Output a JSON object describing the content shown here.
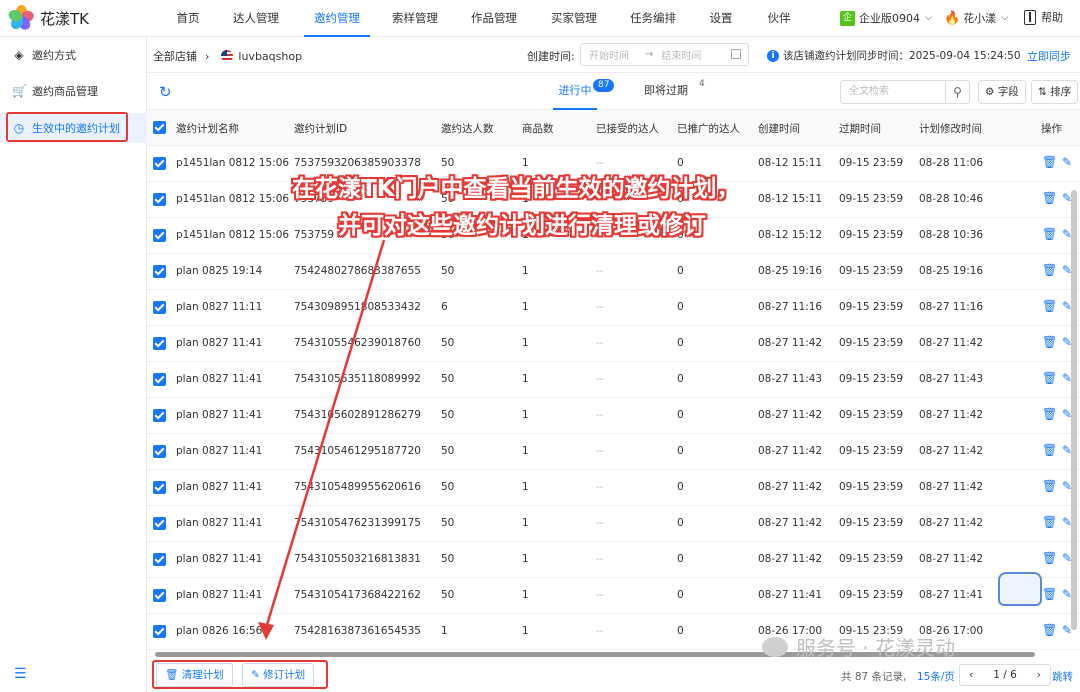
{
  "app": {
    "name": "花漾TK"
  },
  "topnav": {
    "items": [
      "首页",
      "达人管理",
      "邀约管理",
      "索样管理",
      "作品管理",
      "买家管理",
      "任务编排",
      "设置",
      "伙伴"
    ],
    "active_index": 2,
    "edition_icon": "企",
    "edition": "企业版0904",
    "user": "花小漾",
    "help": "帮助"
  },
  "sidebar": {
    "items": [
      {
        "label": "邀约方式",
        "icon": "tag-icon"
      },
      {
        "label": "邀约商品管理",
        "icon": "cart-icon"
      },
      {
        "label": "生效中的邀约计划",
        "icon": "clock-icon"
      }
    ],
    "active_index": 2
  },
  "filterbar": {
    "breadcrumb_root": "全部店铺",
    "shop": "luvbaqshop",
    "created_label": "创建时间:",
    "start_placeholder": "开始时间",
    "end_placeholder": "结束时间",
    "sync_info": "该店铺邀约计划同步时间：2025-09-04 15:24:50",
    "sync_now": "立即同步"
  },
  "tabs": [
    {
      "label": "进行中",
      "badge": "87"
    },
    {
      "label": "即将过期",
      "badge": "4"
    }
  ],
  "toolbar": {
    "search_placeholder": "全文检索",
    "fields_label": "字段",
    "sort_label": "排序"
  },
  "table": {
    "columns": [
      "邀约计划名称",
      "邀约计划ID",
      "邀约达人数",
      "商品数",
      "已接受的达人",
      "已推广的达人",
      "创建时间",
      "过期时间",
      "计划修改时间",
      "操作"
    ],
    "rows": [
      [
        "p1451lan 0812 15:06",
        "7537593206385903378",
        "50",
        "1",
        "--",
        "0",
        "08-12 15:11",
        "09-15 23:59",
        "08-28 11:06"
      ],
      [
        "p1451lan 0812 15:06",
        "753759",
        "50",
        "1",
        "--",
        "0",
        "08-12 15:11",
        "09-15 23:59",
        "08-28 10:46"
      ],
      [
        "p1451lan 0812 15:06",
        "753759",
        "50",
        "1",
        "--",
        "0",
        "08-12 15:12",
        "09-15 23:59",
        "08-28 10:36"
      ],
      [
        "plan 0825 19:14",
        "7542480278683387655",
        "50",
        "1",
        "--",
        "0",
        "08-25 19:16",
        "09-15 23:59",
        "08-25 19:16"
      ],
      [
        "plan 0827 11:11",
        "7543098951808533432",
        "6",
        "1",
        "--",
        "0",
        "08-27 11:16",
        "09-15 23:59",
        "08-27 11:16"
      ],
      [
        "plan 0827 11:41",
        "7543105546239018760",
        "50",
        "1",
        "--",
        "0",
        "08-27 11:42",
        "09-15 23:59",
        "08-27 11:42"
      ],
      [
        "plan 0827 11:41",
        "7543105635118089992",
        "50",
        "1",
        "--",
        "0",
        "08-27 11:43",
        "09-15 23:59",
        "08-27 11:43"
      ],
      [
        "plan 0827 11:41",
        "7543105602891286279",
        "50",
        "1",
        "--",
        "0",
        "08-27 11:42",
        "09-15 23:59",
        "08-27 11:42"
      ],
      [
        "plan 0827 11:41",
        "7543105461295187720",
        "50",
        "1",
        "--",
        "0",
        "08-27 11:42",
        "09-15 23:59",
        "08-27 11:42"
      ],
      [
        "plan 0827 11:41",
        "7543105489955620616",
        "50",
        "1",
        "--",
        "0",
        "08-27 11:42",
        "09-15 23:59",
        "08-27 11:42"
      ],
      [
        "plan 0827 11:41",
        "7543105476231399175",
        "50",
        "1",
        "--",
        "0",
        "08-27 11:42",
        "09-15 23:59",
        "08-27 11:42"
      ],
      [
        "plan 0827 11:41",
        "7543105503216813831",
        "50",
        "1",
        "--",
        "0",
        "08-27 11:42",
        "09-15 23:59",
        "08-27 11:42"
      ],
      [
        "plan 0827 11:41",
        "7543105417368422162",
        "50",
        "1",
        "--",
        "0",
        "08-27 11:41",
        "09-15 23:59",
        "08-27 11:41"
      ],
      [
        "plan 0826 16:56",
        "7542816387361654535",
        "1",
        "1",
        "--",
        "0",
        "08-26 17:00",
        "09-15 23:59",
        "08-26 17:00"
      ]
    ]
  },
  "footer": {
    "clean_label": "清理计划",
    "revise_label": "修订计划",
    "total": "共 87 条记录,",
    "per_page": "15条/页",
    "page": "1 / 6",
    "jump": "跳转"
  },
  "annotation": {
    "line1": "在花漾TK门户中查看当前生效的邀约计划，",
    "line2": "并可对这些邀约计划进行清理或修订"
  },
  "watermark": "服务号 · 花漾灵动",
  "colors": {
    "accent": "#1677ff",
    "highlight": "#e53935"
  }
}
